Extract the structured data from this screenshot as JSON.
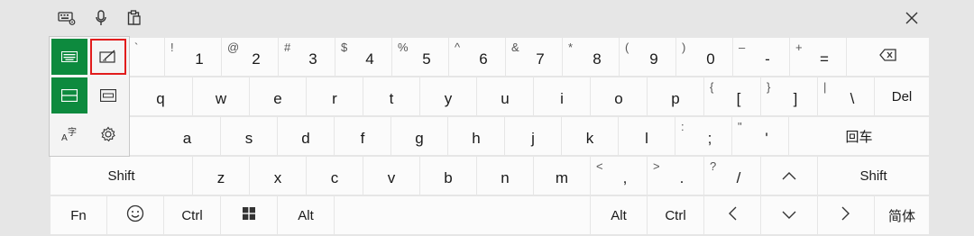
{
  "toolbar": {
    "icons": [
      "keyboard-settings-icon",
      "microphone-icon",
      "clipboard-icon"
    ],
    "close_icon": "close-icon"
  },
  "popup": {
    "items": [
      "keyboard-layout-default-icon",
      "handwriting-icon",
      "keyboard-layout-split-icon",
      "keyboard-layout-compact-icon",
      "ime-mode-icon",
      "settings-gear-icon"
    ]
  },
  "keys": {
    "row1": [
      {
        "sec": "`",
        "pri": ""
      },
      {
        "sec": "!",
        "pri": "1"
      },
      {
        "sec": "@",
        "pri": "2"
      },
      {
        "sec": "#",
        "pri": "3"
      },
      {
        "sec": "$",
        "pri": "4"
      },
      {
        "sec": "%",
        "pri": "5"
      },
      {
        "sec": "^",
        "pri": "6"
      },
      {
        "sec": "&",
        "pri": "7"
      },
      {
        "sec": "*",
        "pri": "8"
      },
      {
        "sec": "(",
        "pri": "9"
      },
      {
        "sec": ")",
        "pri": "0"
      },
      {
        "sec": "–",
        "pri": "-"
      },
      {
        "sec": "+",
        "pri": "="
      }
    ],
    "backspace_icon": "backspace-icon",
    "row2": [
      "q",
      "w",
      "e",
      "r",
      "t",
      "y",
      "u",
      "i",
      "o",
      "p"
    ],
    "row2_brackets": [
      {
        "sec": "{",
        "pri": "["
      },
      {
        "sec": "}",
        "pri": "]"
      },
      {
        "sec": "|",
        "pri": "\\"
      }
    ],
    "del": "Del",
    "row3": [
      "a",
      "s",
      "d",
      "f",
      "g",
      "h",
      "j",
      "k",
      "l"
    ],
    "row3_punct": [
      {
        "sec": ":",
        "pri": ";"
      },
      {
        "sec": "\"",
        "pri": "'"
      }
    ],
    "enter": "回车",
    "shift_left": "Shift",
    "row4": [
      "z",
      "x",
      "c",
      "v",
      "b",
      "n",
      "m"
    ],
    "row4_punct": [
      {
        "sec": "<",
        "pri": ","
      },
      {
        "sec": ">",
        "pri": "."
      },
      {
        "sec": "?",
        "pri": "/"
      }
    ],
    "arrow_up_icon": "arrow-up-icon",
    "shift_right": "Shift",
    "fn": "Fn",
    "emoji_icon": "emoji-icon",
    "ctrl_left": "Ctrl",
    "windows_icon": "windows-icon",
    "alt_left": "Alt",
    "alt_right": "Alt",
    "ctrl_right": "Ctrl",
    "arrow_left_icon": "arrow-left-icon",
    "arrow_down_icon": "arrow-down-icon",
    "arrow_right_icon": "arrow-right-icon",
    "lang": "简体"
  }
}
